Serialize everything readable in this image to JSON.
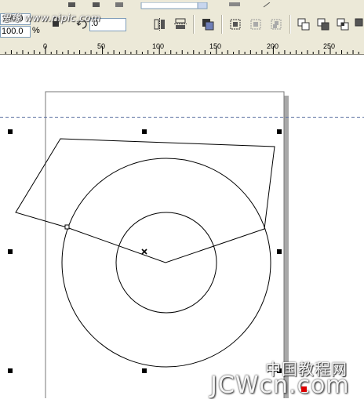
{
  "property_bar": {
    "width_scale_value": "100.0",
    "height_scale_value": "100.0",
    "percent_label": "%",
    "rotation_value": ".0"
  },
  "watermarks": {
    "top_text": "思缘 www.nipic.com",
    "brand_cn": "中国教程网",
    "brand_en": "JCWcn.com"
  },
  "ruler": {
    "labels": [
      "0",
      "50",
      "100",
      "150",
      "200",
      "250"
    ]
  },
  "colors": {
    "toolbar_bg": "#ece9d8",
    "guideline": "#5a6fa0",
    "page_shadow": "#a8a8a8",
    "brand_red": "#dd0000"
  }
}
